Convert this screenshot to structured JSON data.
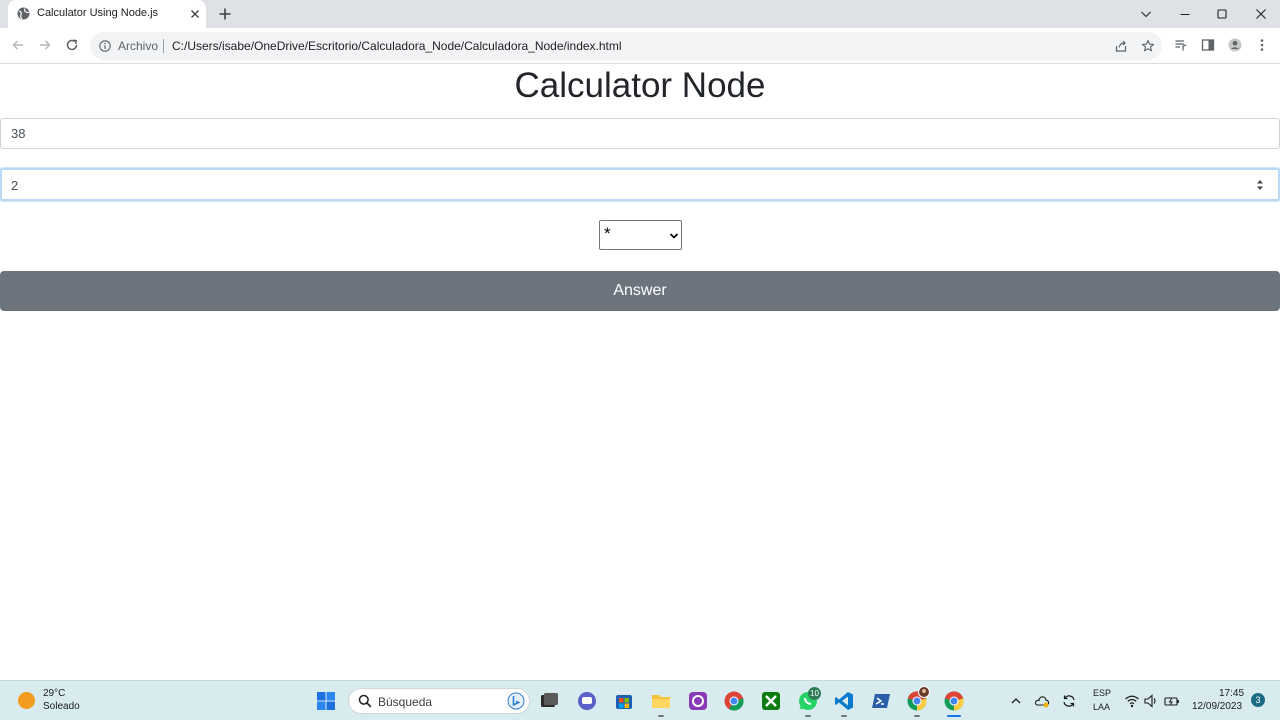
{
  "browser": {
    "tab": {
      "title": "Calculator Using Node.js"
    },
    "omnibox": {
      "scheme_label": "Archivo",
      "url": "C:/Users/isabe/OneDrive/Escritorio/Calculadora_Node/Calculadora_Node/index.html"
    }
  },
  "page": {
    "title": "Calculator Node",
    "number1": "38",
    "number2": "2",
    "operator": "*",
    "answer_label": "Answer",
    "button_color": "#6c757d"
  },
  "taskbar": {
    "weather": {
      "temp": "29°C",
      "condition": "Soleado"
    },
    "search_placeholder": "Búsqueda",
    "whatsapp_badge": "10",
    "lang": {
      "line1": "ESP",
      "line2": "LAA"
    },
    "clock": {
      "time": "17:45",
      "date": "12/09/2023"
    },
    "notifications": "3"
  }
}
